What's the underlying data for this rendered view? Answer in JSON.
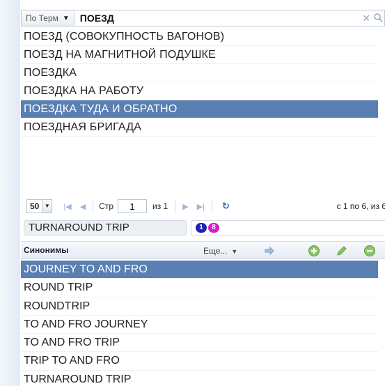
{
  "search": {
    "mode": "По Терм",
    "query": "ПОЕЗД"
  },
  "terms": [
    {
      "label": "ПОЕЗД (СОВОКУПНОСТЬ ВАГОНОВ)",
      "selected": false
    },
    {
      "label": "ПОЕЗД НА МАГНИТНОЙ ПОДУШКЕ",
      "selected": false
    },
    {
      "label": "ПОЕЗДКА",
      "selected": false
    },
    {
      "label": "ПОЕЗДКА НА РАБОТУ",
      "selected": false
    },
    {
      "label": "ПОЕЗДКА ТУДА И ОБРАТНО",
      "selected": true
    },
    {
      "label": "ПОЕЗДНАЯ БРИГАДА",
      "selected": false
    }
  ],
  "pager": {
    "page_size": "50",
    "page_label": "Стр",
    "page_value": "1",
    "of_label": "из 1",
    "info": "с 1 по 6, из 6"
  },
  "selected_term": {
    "label": "TURNAROUND TRIP",
    "badge1": "1",
    "badge2": "8"
  },
  "synonyms": {
    "title": "Синонимы",
    "more": "Еще...",
    "items": [
      {
        "label": "JOURNEY TO AND FRO",
        "selected": true
      },
      {
        "label": "ROUND TRIP",
        "selected": false
      },
      {
        "label": "ROUNDTRIP",
        "selected": false
      },
      {
        "label": "TO AND FRO JOURNEY",
        "selected": false
      },
      {
        "label": "TO AND FRO TRIP",
        "selected": false
      },
      {
        "label": "TRIP TO AND FRO",
        "selected": false
      },
      {
        "label": "TURNAROUND TRIP",
        "selected": false
      }
    ]
  },
  "colors": {
    "selection": "#5a7fb2",
    "badge1": "#1f22b8",
    "badge2": "#d321c8"
  }
}
